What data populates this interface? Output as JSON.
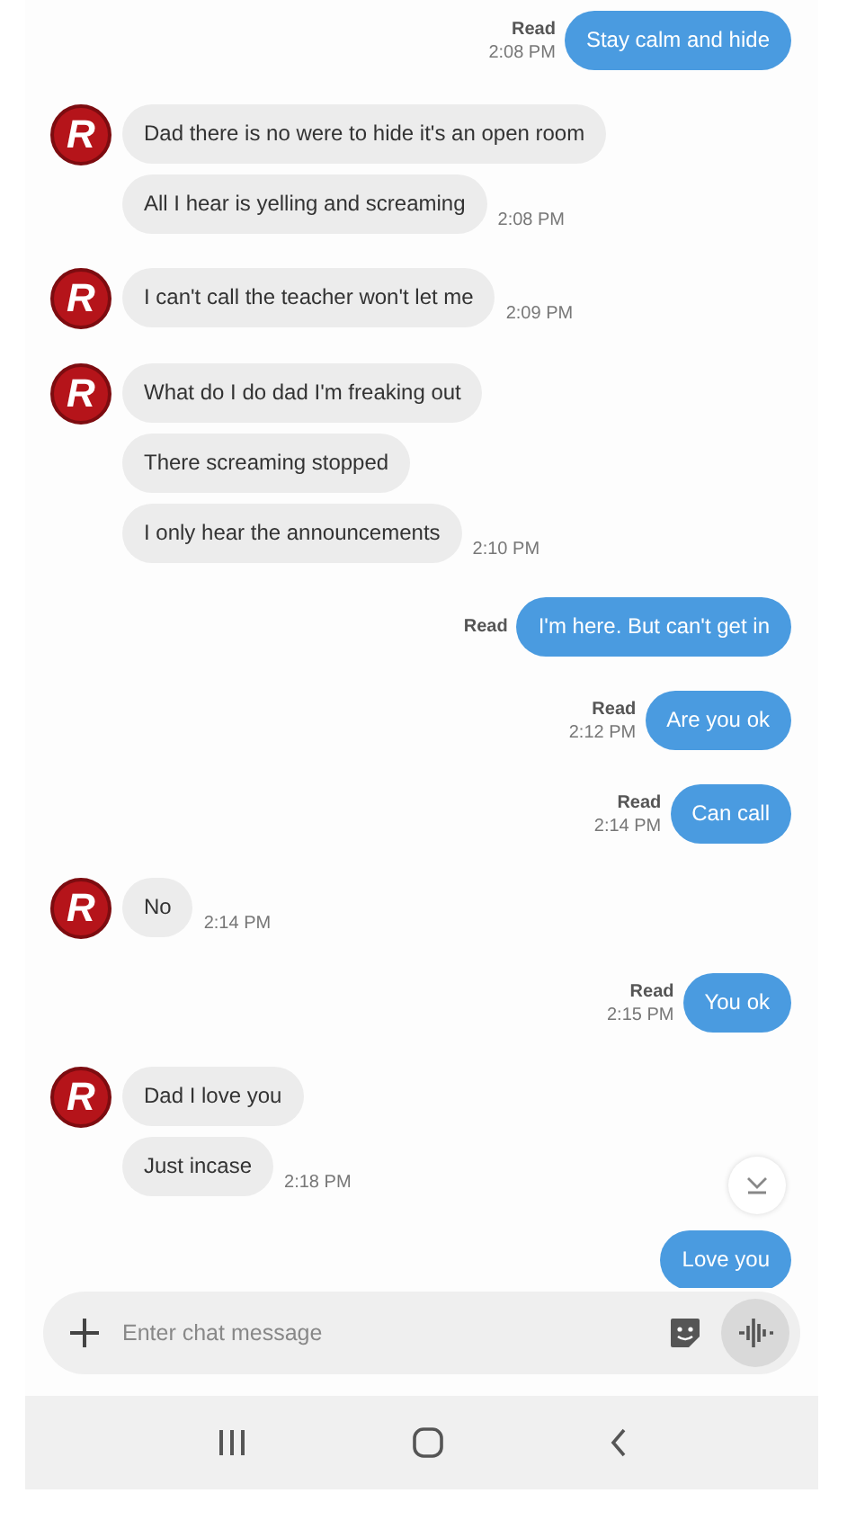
{
  "messages": [
    {
      "kind": "sent",
      "text": "Stay calm and hide",
      "read": "Read",
      "time": "2:08 PM"
    },
    {
      "kind": "received",
      "avatar": "R",
      "bubbles": [
        "Dad there is no were to hide it's an open room",
        "All I hear is yelling and screaming"
      ],
      "time": "2:08 PM"
    },
    {
      "kind": "received",
      "avatar": "R",
      "bubbles": [
        "I can't call the teacher won't let me"
      ],
      "time": "2:09 PM"
    },
    {
      "kind": "received",
      "avatar": "R",
      "bubbles": [
        "What do I do dad I'm freaking out",
        "There screaming stopped",
        "I only hear the announcements"
      ],
      "time": "2:10 PM"
    },
    {
      "kind": "sent",
      "text": "I'm here. But can't get in",
      "read": "Read"
    },
    {
      "kind": "sent",
      "text": "Are you ok",
      "read": "Read",
      "time": "2:12 PM"
    },
    {
      "kind": "sent",
      "text": "Can call",
      "read": "Read",
      "time": "2:14 PM"
    },
    {
      "kind": "received",
      "avatar": "R",
      "bubbles": [
        "No"
      ],
      "time": "2:14 PM"
    },
    {
      "kind": "sent",
      "text": "You ok",
      "read": "Read",
      "time": "2:15 PM"
    },
    {
      "kind": "received",
      "avatar": "R",
      "bubbles": [
        "Dad I love you",
        "Just incase"
      ],
      "time": "2:18 PM"
    },
    {
      "kind": "sent",
      "text": "Love you"
    }
  ],
  "composer": {
    "placeholder": "Enter chat message"
  }
}
